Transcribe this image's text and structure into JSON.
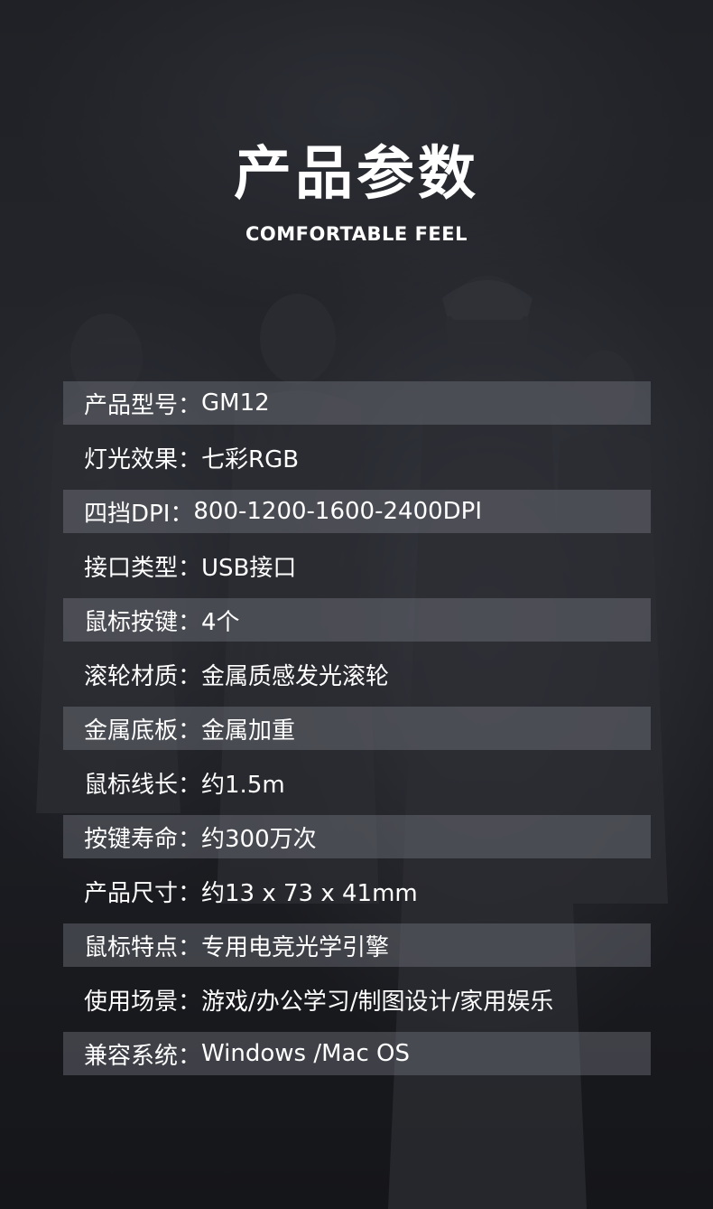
{
  "header": {
    "title": "产品参数",
    "subtitle": "COMFORTABLE FEEL"
  },
  "specs": [
    {
      "label": "产品型号：",
      "value": "GM12",
      "shaded": true
    },
    {
      "label": "灯光效果：",
      "value": "七彩RGB",
      "shaded": false
    },
    {
      "label": "四挡DPI：",
      "value": "800-1200-1600-2400DPI",
      "shaded": true
    },
    {
      "label": "接口类型：",
      "value": "USB接口",
      "shaded": false
    },
    {
      "label": "鼠标按键：",
      "value": "4个",
      "shaded": true
    },
    {
      "label": "滚轮材质：",
      "value": " 金属质感发光滚轮",
      "shaded": false
    },
    {
      "label": "金属底板：",
      "value": " 金属加重",
      "shaded": true
    },
    {
      "label": "鼠标线长：",
      "value": "约1.5m",
      "shaded": false
    },
    {
      "label": "按键寿命：",
      "value": "约300万次",
      "shaded": true
    },
    {
      "label": "产品尺寸：",
      "value": "约13 x 73 x 41mm",
      "shaded": false
    },
    {
      "label": "鼠标特点：",
      "value": "专用电竞光学引擎",
      "shaded": true
    },
    {
      "label": "使用场景：",
      "value": "游戏/办公学习/制图设计/家用娱乐",
      "shaded": false
    },
    {
      "label": "兼容系统：",
      "value": "Windows /Mac OS",
      "shaded": true
    }
  ]
}
